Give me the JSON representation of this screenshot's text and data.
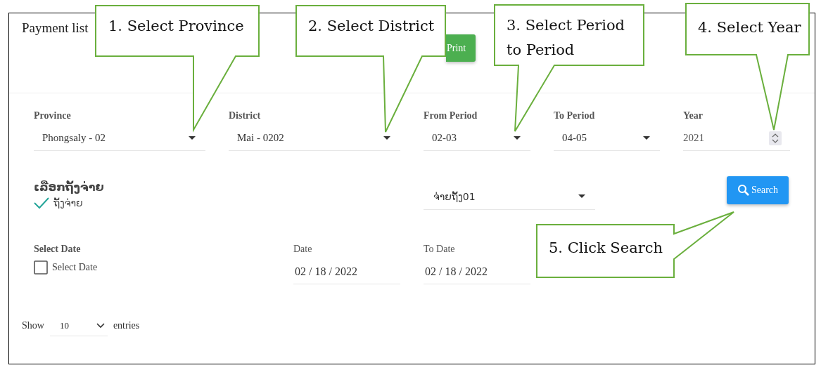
{
  "header": {
    "title": "Payment list",
    "print_button": "Print"
  },
  "filters": [
    {
      "label": "Province",
      "value": "Phongsaly - 02",
      "kind": "select"
    },
    {
      "label": "District",
      "value": "Mai - 0202",
      "kind": "select"
    },
    {
      "label": "From Period",
      "value": "02-03",
      "kind": "select"
    },
    {
      "label": "To Period",
      "value": "04-05",
      "kind": "select"
    },
    {
      "label": "Year",
      "value": "2021",
      "kind": "number"
    }
  ],
  "installment": {
    "title": "ເລືອກຖັ້ງຈ່າຍ",
    "option": {
      "label": "ຖັ້ງຈ່າຍ",
      "checked": true
    },
    "select_value": "ຈ່າຍຖັ້ງ01"
  },
  "search_button": "Search",
  "date_filter": {
    "title": "Select Date",
    "checkbox": {
      "label": "Select Date",
      "checked": false
    },
    "date": {
      "label": "Date",
      "value": "02 / 18 / 2022"
    },
    "to_date": {
      "label": "To Date",
      "value": "02 / 18 / 2022"
    }
  },
  "page_size": {
    "before": "Show",
    "value": "10",
    "after": "entries"
  },
  "callouts": [
    {
      "text": "1. Select Province"
    },
    {
      "text": "2. Select District"
    },
    {
      "text": "3. Select Period to Period"
    },
    {
      "text": "4. Select Year"
    },
    {
      "text": "5. Click Search"
    }
  ]
}
